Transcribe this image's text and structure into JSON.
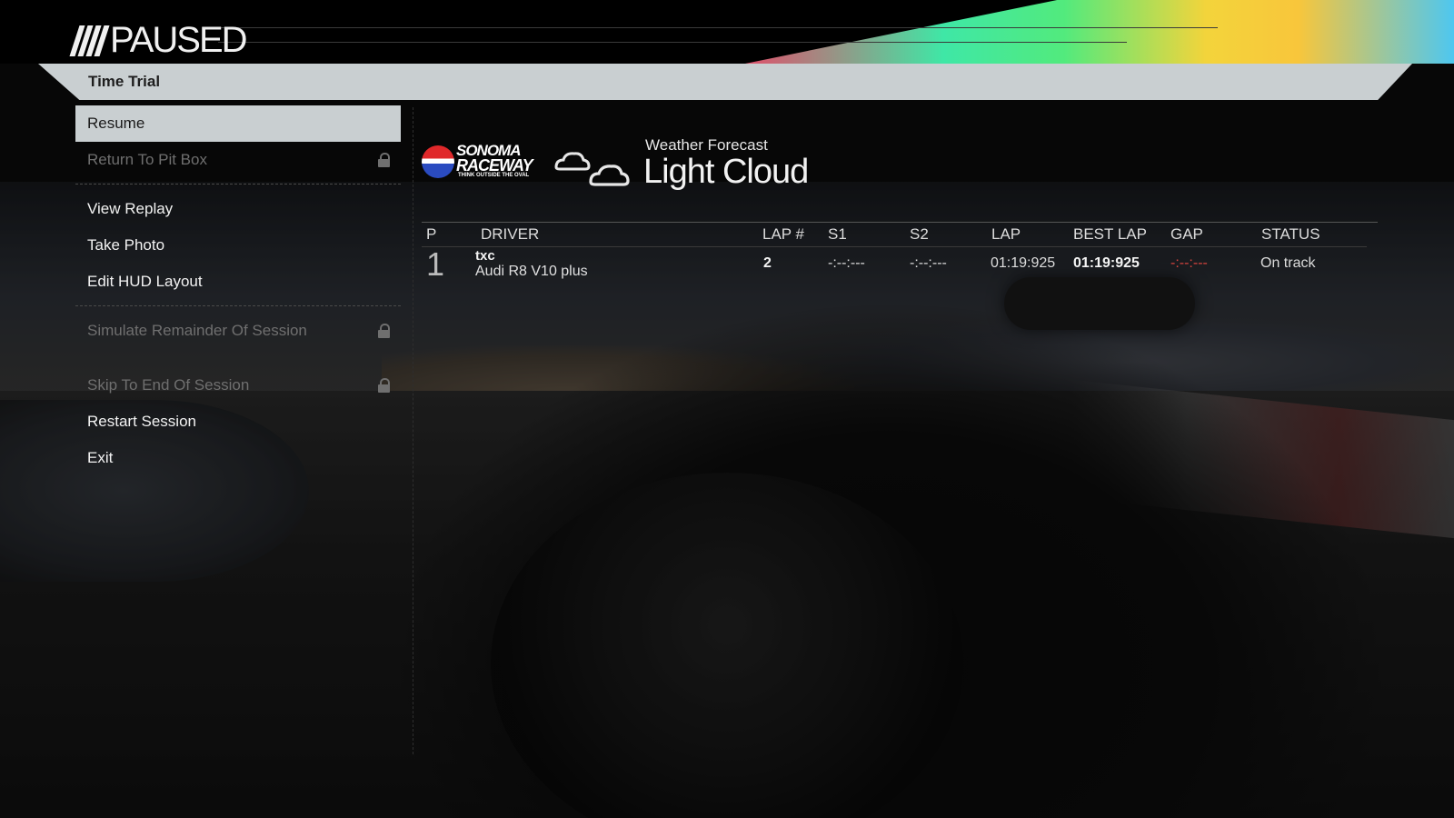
{
  "header": {
    "title": "PAUSED",
    "mode": "Time Trial"
  },
  "menu": {
    "items": [
      {
        "label": "Resume",
        "state": "selected"
      },
      {
        "label": "Return To Pit Box",
        "state": "locked"
      },
      {
        "label": "View Replay",
        "state": "enabled"
      },
      {
        "label": "Take Photo",
        "state": "enabled"
      },
      {
        "label": "Edit HUD Layout",
        "state": "enabled"
      },
      {
        "label": "Simulate Remainder Of Session",
        "state": "locked"
      },
      {
        "label": "Skip To End Of Session",
        "state": "locked"
      },
      {
        "label": "Restart Session",
        "state": "enabled"
      },
      {
        "label": "Exit",
        "state": "enabled"
      }
    ]
  },
  "track": {
    "logo_line1": "SONOMA",
    "logo_line2": "RACEWAY",
    "logo_tagline": "THINK OUTSIDE THE OVAL"
  },
  "weather": {
    "label": "Weather Forecast",
    "value": "Light Cloud",
    "icon": "cloud-icon"
  },
  "results": {
    "columns": [
      "P",
      "DRIVER",
      "LAP #",
      "S1",
      "S2",
      "LAP",
      "BEST LAP",
      "GAP",
      "STATUS"
    ],
    "rows": [
      {
        "position": "1",
        "driver": "txc",
        "car": "Audi R8 V10 plus",
        "lap_num": "2",
        "s1": "-:--:---",
        "s2": "-:--:---",
        "lap": "01:19:925",
        "best_lap": "01:19:925",
        "gap": "-:--:---",
        "status": "On track"
      }
    ]
  },
  "colors": {
    "menu_selected_bg": "#c9cfd1",
    "gap_red": "#d8443e",
    "disabled_text": "#6f6f6f"
  }
}
